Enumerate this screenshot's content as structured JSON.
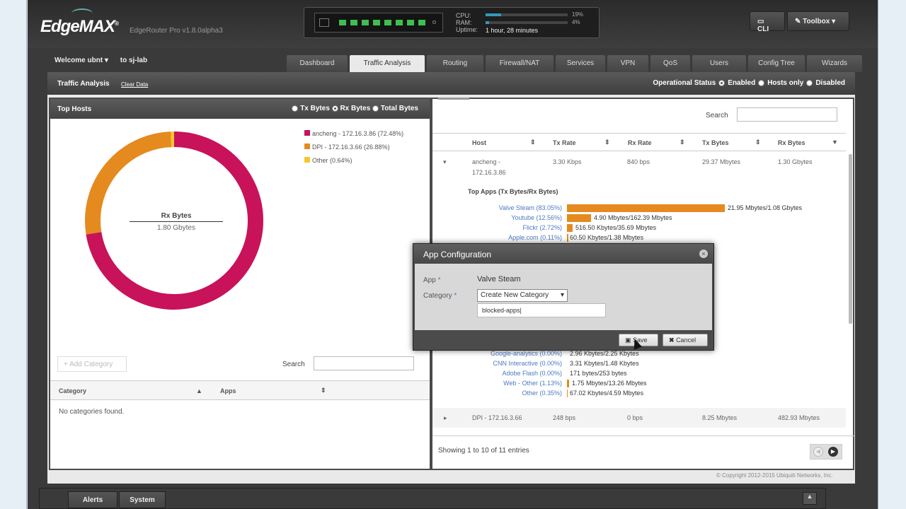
{
  "header": {
    "brand": "EdgeMAX",
    "version": "EdgeRouter Pro v1.8.0alpha3",
    "cpu_label": "CPU:",
    "ram_label": "RAM:",
    "uptime_label": "Uptime:",
    "uptime_value": "1 hour, 28 minutes",
    "cpu_pct": "19%",
    "ram_pct": "4%",
    "cpu_level": 0.19,
    "ram_level": 0.04,
    "cli_label": "CLI",
    "toolbox_label": "Toolbox"
  },
  "welcome": {
    "text": "Welcome ubnt",
    "host": "to sj-lab"
  },
  "tabs": [
    "Dashboard",
    "Traffic Analysis",
    "Routing",
    "Firewall/NAT",
    "Services",
    "VPN",
    "QoS",
    "Users",
    "Config Tree",
    "Wizards"
  ],
  "active_tab": "Traffic Analysis",
  "subheader": {
    "title": "Traffic Analysis",
    "clear": "Clear Data",
    "op_status": "Operational Status",
    "enabled": "Enabled",
    "hosts_only": "Hosts only",
    "disabled": "Disabled"
  },
  "top_hosts": {
    "title": "Top Hosts",
    "opt_tx": "Tx Bytes",
    "opt_rx": "Rx Bytes",
    "opt_total": "Total Bytes",
    "center_label": "Rx Bytes",
    "center_value": "1.80 Gbytes",
    "legend": [
      {
        "label": "ancheng - 172.16.3.86 (72.48%)",
        "color": "#c8125a"
      },
      {
        "label": "DPI - 172.16.3.66 (26.88%)",
        "color": "#e58a1f"
      },
      {
        "label": "Other (0.64%)",
        "color": "#f2c82e"
      }
    ]
  },
  "chart_data": {
    "type": "pie",
    "categories": [
      "ancheng - 172.16.3.86",
      "DPI - 172.16.3.66",
      "Other"
    ],
    "values": [
      72.48,
      26.88,
      0.64
    ],
    "colors": [
      "#c8125a",
      "#e58a1f",
      "#f2c82e"
    ]
  },
  "categories_panel": {
    "add_label": "+ Add Category",
    "search_label": "Search",
    "col_category": "Category",
    "col_apps": "Apps",
    "empty": "No categories found."
  },
  "hosts_table": {
    "search_label": "Search",
    "columns": [
      "Host",
      "Tx Rate",
      "Rx Rate",
      "Tx Bytes",
      "Rx Bytes"
    ],
    "row1": {
      "host_line1": "ancheng -",
      "host_line2": "172.16.3.86",
      "tx_rate": "3.30 Kbps",
      "rx_rate": "840 bps",
      "tx_bytes": "29.37 Mbytes",
      "rx_bytes": "1.30 Gbytes"
    },
    "top_apps_title": "Top Apps (Tx Bytes/Rx Bytes)",
    "row2": {
      "host": "DPI - 172.16.3.66",
      "tx_rate": "248 bps",
      "rx_rate": "0 bps",
      "tx_bytes": "8.25 Mbytes",
      "rx_bytes": "482.93 Mbytes"
    },
    "showing": "Showing 1 to 10 of 11 entries"
  },
  "apps_top": [
    {
      "name": "Valve Steam (83.05%)",
      "value": "21.95 Mbytes/1.08 Gbytes"
    },
    {
      "name": "Youtube (12.56%)",
      "value": "4.90 Mbytes/162.39 Mbytes"
    },
    {
      "name": "Flickr (2.72%)",
      "value": "516.50 Kbytes/35.69 Mbytes"
    },
    {
      "name": "Apple.com (0.11%)",
      "value": "60.50 Kbytes/1.38 Mbytes"
    }
  ],
  "apps_bottom": [
    {
      "name": "Google-analytics (0.00%)",
      "value": "2.96 Kbytes/2.25 Kbytes"
    },
    {
      "name": "CNN Interactive (0.00%)",
      "value": "3.31 Kbytes/1.48 Kbytes"
    },
    {
      "name": "Adobe Flash (0.00%)",
      "value": "171 bytes/253 bytes"
    },
    {
      "name": "Web - Other (1.13%)",
      "value": "1.75 Mbytes/13.26 Mbytes"
    },
    {
      "name": "Other (0.35%)",
      "value": "67.02 Kbytes/4.59 Mbytes"
    }
  ],
  "modal": {
    "title": "App Configuration",
    "app_label": "App",
    "app_value": "Valve Steam",
    "category_label": "Category",
    "category_select": "Create New Category",
    "new_category_value": "blocked-apps",
    "required": "*",
    "save": "Save",
    "cancel": "Cancel"
  },
  "footer": {
    "copyright": "© Copyright 2012-2015 Ubiquiti Networks, Inc.",
    "alerts": "Alerts",
    "system": "System"
  }
}
